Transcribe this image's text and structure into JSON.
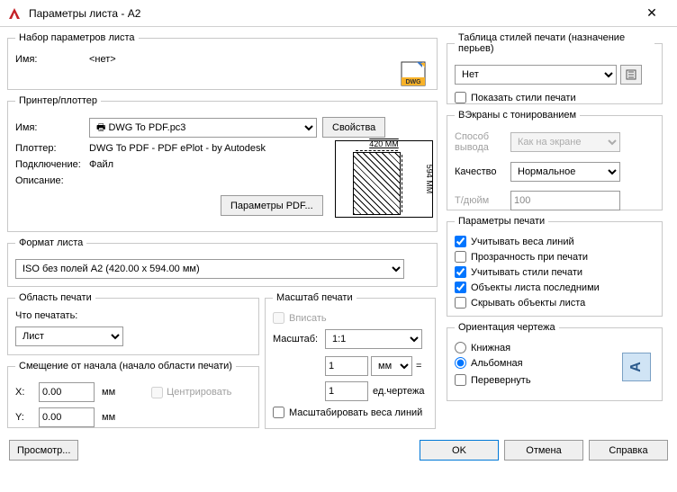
{
  "window": {
    "title": "Параметры листа - A2"
  },
  "pageSetup": {
    "legend": "Набор параметров листа",
    "nameLabel": "Имя:",
    "nameValue": "<нет>"
  },
  "printer": {
    "legend": "Принтер/плоттер",
    "nameLabel": "Имя:",
    "nameValue": "DWG To PDF.pc3",
    "propertiesBtn": "Свойства",
    "plotterLabel": "Плоттер:",
    "plotterValue": "DWG To PDF - PDF ePlot - by Autodesk",
    "connectLabel": "Подключение:",
    "connectValue": "Файл",
    "descLabel": "Описание:",
    "descValue": "",
    "pdfParamsBtn": "Параметры PDF...",
    "previewTop": "420 MM",
    "previewRight": "594 MM"
  },
  "paper": {
    "legend": "Формат листа",
    "value": "ISO без полей A2 (420.00 x 594.00 мм)"
  },
  "plotArea": {
    "legend": "Область печати",
    "whatLabel": "Что печатать:",
    "value": "Лист"
  },
  "scale": {
    "legend": "Масштаб печати",
    "fitLabel": "Вписать",
    "scaleLabel": "Масштаб:",
    "scaleValue": "1:1",
    "num": "1",
    "unit": "мм",
    "denom": "1",
    "drawingUnits": "ед.чертежа",
    "scaleLwLabel": "Масштабировать веса линий"
  },
  "offset": {
    "legend": "Смещение от начала (начало области печати)",
    "xLabel": "X:",
    "xValue": "0.00",
    "yLabel": "Y:",
    "yValue": "0.00",
    "unit": "мм",
    "centerLabel": "Центрировать"
  },
  "styleTable": {
    "legend": "Таблица стилей печати (назначение перьев)",
    "value": "Нет",
    "showStylesLabel": "Показать стили печати"
  },
  "shaded": {
    "legend": "ВЭкраны с тонированием",
    "modeLabel": "Способ вывода",
    "modeValue": "Как на экране",
    "qualityLabel": "Качество",
    "qualityValue": "Нормальное",
    "dpiLabel": "Т/дюйм",
    "dpiValue": "100"
  },
  "options": {
    "legend": "Параметры печати",
    "lwLabel": "Учитывать веса линий",
    "transLabel": "Прозрачность при печати",
    "stylesLabel": "Учитывать стили печати",
    "lastLabel": "Объекты листа последними",
    "hideLabel": "Скрывать объекты листа"
  },
  "orient": {
    "legend": "Ориентация чертежа",
    "portraitLabel": "Книжная",
    "landscapeLabel": "Альбомная",
    "upsideLabel": "Перевернуть",
    "glyph": "A"
  },
  "footer": {
    "preview": "Просмотр...",
    "ok": "OK",
    "cancel": "Отмена",
    "help": "Справка"
  }
}
